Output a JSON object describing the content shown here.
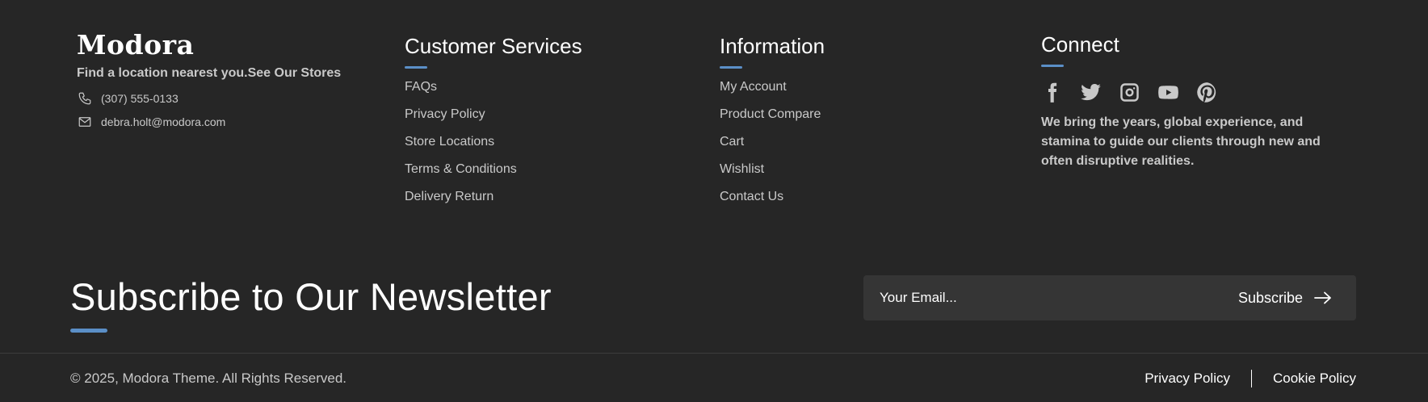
{
  "brand": {
    "logo": "Modora",
    "tagline": "Find a location nearest you.See Our Stores",
    "phone": "(307) 555-0133",
    "email": "debra.holt@modora.com",
    "phone_icon": "phone-icon",
    "email_icon": "mail-icon"
  },
  "customer_services": {
    "title": "Customer Services",
    "links": [
      "FAQs",
      "Privacy Policy",
      "Store Locations",
      "Terms & Conditions",
      "Delivery Return"
    ]
  },
  "information": {
    "title": "Information",
    "links": [
      "My Account",
      "Product Compare",
      "Cart",
      "Wishlist",
      "Contact Us"
    ]
  },
  "connect": {
    "title": "Connect",
    "social_icons": [
      "facebook-icon",
      "twitter-icon",
      "instagram-icon",
      "youtube-icon",
      "pinterest-icon"
    ],
    "text": "We bring the years, global experience, and stamina to guide our clients through new and often disruptive realities."
  },
  "newsletter": {
    "title": "Subscribe to Our Newsletter",
    "email_placeholder": "Your Email...",
    "subscribe_label": "Subscribe",
    "subscribe_icon": "arrow-right-icon"
  },
  "footer": {
    "copyright": "© 2025, Modora Theme. All Rights Reserved.",
    "privacy_label": "Privacy Policy",
    "cookie_label": "Cookie Policy"
  },
  "colors": {
    "background": "#262626",
    "accent": "#5b8fc7",
    "input_background": "#353535",
    "text": "#c9c9c9",
    "heading": "#ffffff"
  }
}
